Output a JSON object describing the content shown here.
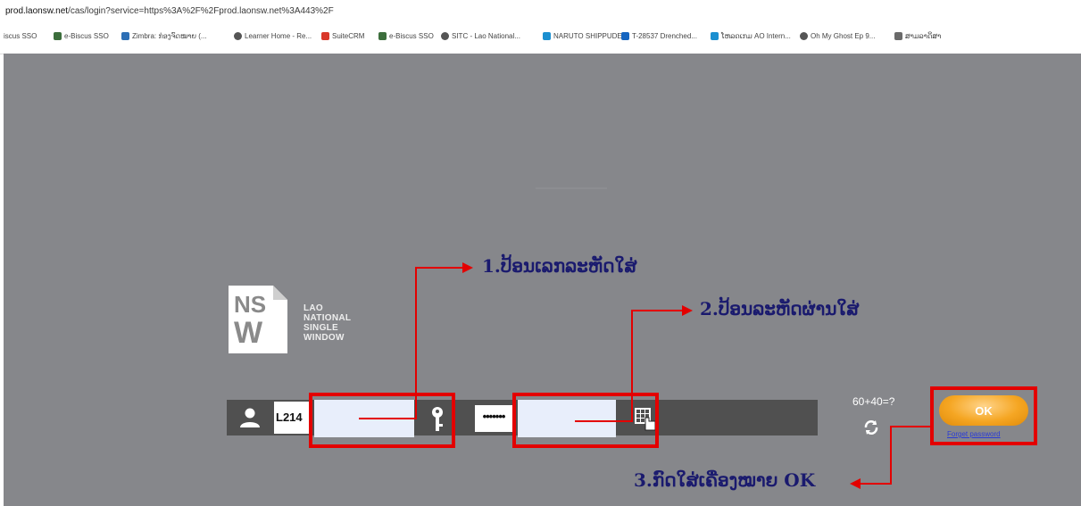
{
  "browser": {
    "url_host": "prod.laonsw.net",
    "url_rest": "/cas/login?service=https%3A%2F%2Fprod.laonsw.net%3A443%2F",
    "bookmarks": [
      {
        "label": "iscus SSO",
        "icon": "none"
      },
      {
        "label": "e-Biscus SSO",
        "icon": "doc-icon"
      },
      {
        "label": "Zimbra: ກ່ອງຈົດໝາຍ (...",
        "icon": "zimbra-icon"
      },
      {
        "label": "Learner Home - Re...",
        "icon": "globe-icon"
      },
      {
        "label": "SuiteCRM",
        "icon": "suitecrm-icon"
      },
      {
        "label": "e-Biscus SSO",
        "icon": "doc-icon"
      },
      {
        "label": "SITC - Lao National...",
        "icon": "globe-icon"
      },
      {
        "label": "NARUTO SHIPPUDE...",
        "icon": "tv-icon"
      },
      {
        "label": "T-28537 Drenched...",
        "icon": "drop-icon"
      },
      {
        "label": "ໂຫລດເກມ AO Intern...",
        "icon": "tv-icon"
      },
      {
        "label": "Oh My Ghost Ep 9...",
        "icon": "globe-icon"
      },
      {
        "label": "ສາມລາດິສາ",
        "icon": "app-icon"
      }
    ]
  },
  "brand": {
    "logo_letters": "NSW",
    "name_lines": [
      "LAO",
      "NATIONAL",
      "SINGLE",
      "WINDOW"
    ]
  },
  "login": {
    "username_prefix": "L214",
    "username_value": "",
    "password_mask": "•••••••",
    "password_value": "",
    "captcha": "60+40=?",
    "ok_label": "OK",
    "forget_label": "Forget password"
  },
  "annotations": {
    "step1": "1.ປ້ອນເລກລະຫັດໃສ່",
    "step2": "2.ປ້ອນລະຫັດຜ່ານໃສ່",
    "step3": "3.ກົດໃສ່ເຄື່ອງໝາຍ OK"
  },
  "colors": {
    "page_bg": "#86878b",
    "bar_bg": "#505050",
    "highlight": "#e30000",
    "ok_orange": "#f5a623",
    "annotation_text": "#1a1a6e"
  }
}
